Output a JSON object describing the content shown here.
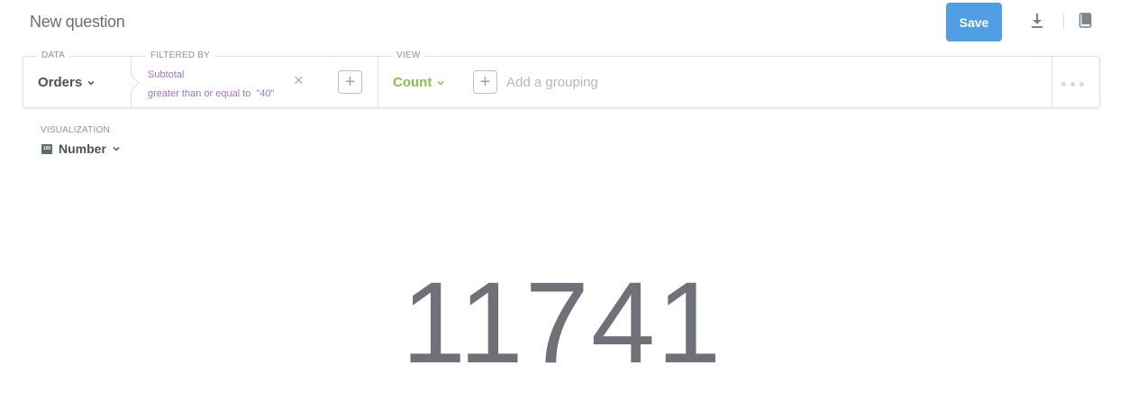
{
  "header": {
    "title": "New question",
    "save_label": "Save",
    "icons": [
      "download-icon",
      "book-icon"
    ]
  },
  "query": {
    "data_label": "DATA",
    "data_source": "Orders",
    "filtered_by_label": "FILTERED BY",
    "filter": {
      "field": "Subtotal",
      "operator": "greater than or equal to",
      "value": "\"40\""
    },
    "filter_remove": "×",
    "add_symbol": "+",
    "view_label": "VIEW",
    "aggregation": "Count",
    "add_grouping": "Add a grouping"
  },
  "visualization": {
    "label": "VISUALIZATION",
    "type": "Number",
    "icon_text": "100"
  },
  "result": {
    "value": "11741"
  },
  "colors": {
    "brand": "#509ee3",
    "filter": "#9a74c8",
    "aggregation": "#88bf4d",
    "number": "#707178"
  }
}
